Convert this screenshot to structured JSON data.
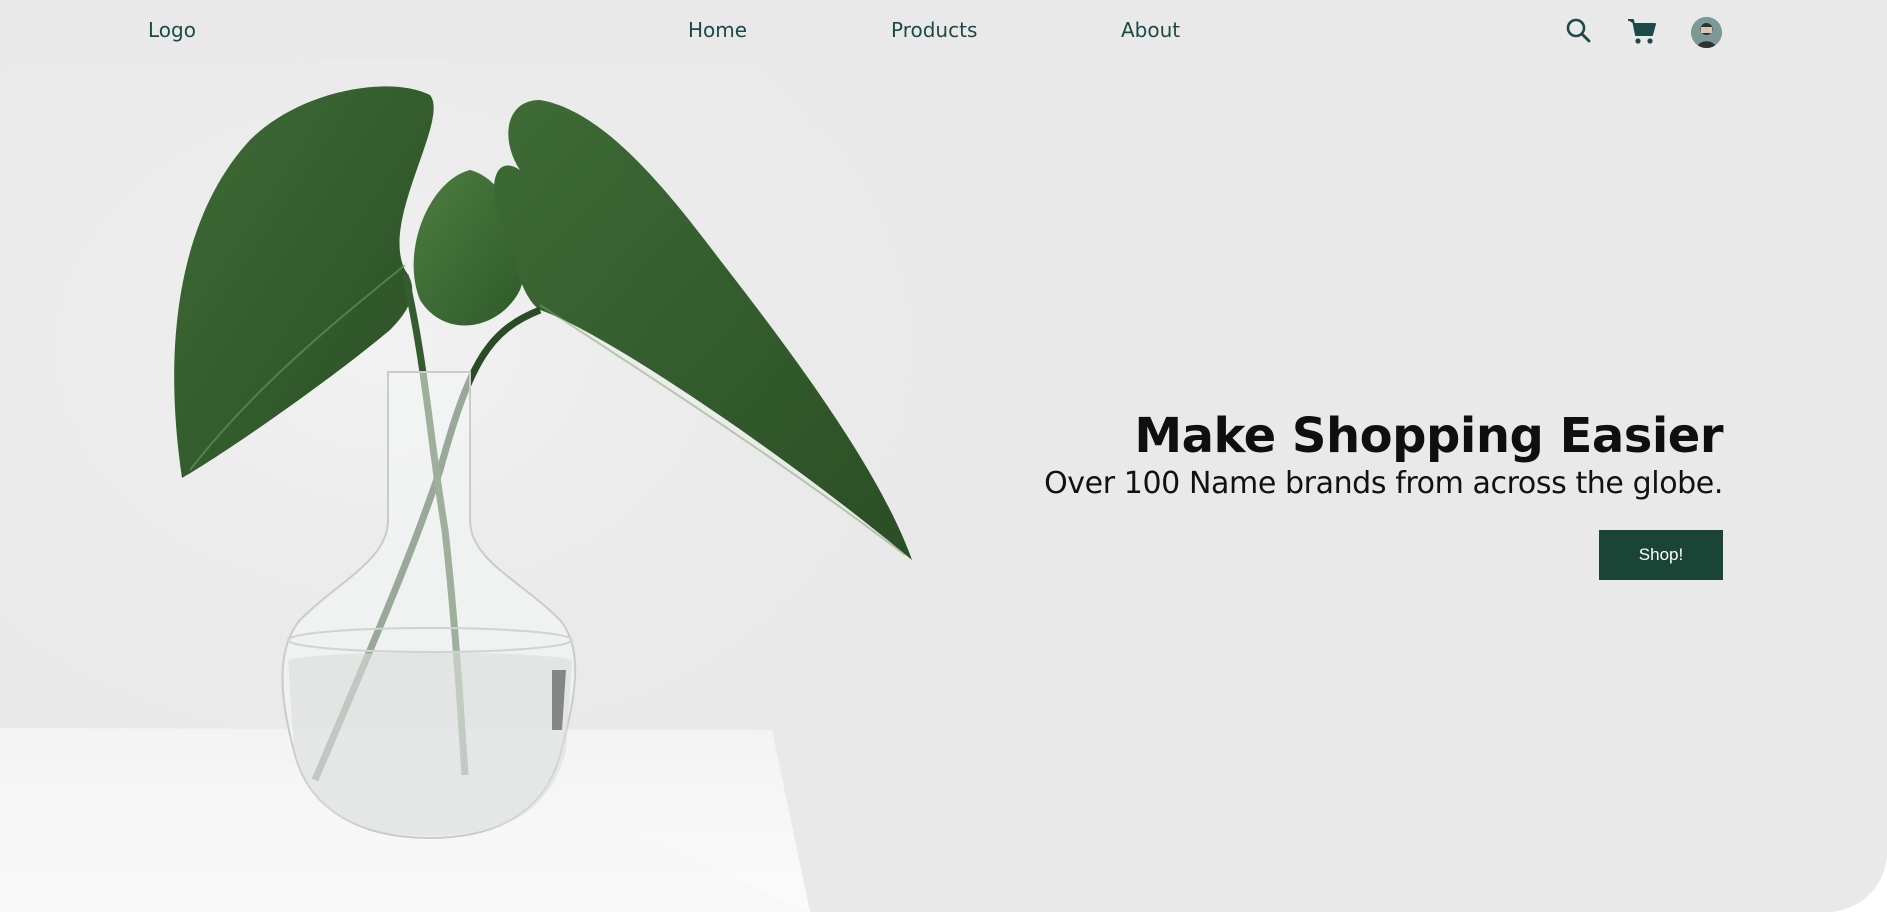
{
  "nav": {
    "logo": "Logo",
    "links": [
      {
        "label": "Home"
      },
      {
        "label": "Products"
      },
      {
        "label": "About"
      }
    ],
    "icons": [
      "search-icon",
      "cart-icon",
      "avatar"
    ]
  },
  "hero": {
    "headline": "Make Shopping Easier",
    "subheadline": "Over 100 Name brands from across the globe.",
    "cta_label": "Shop!"
  },
  "colors": {
    "accent": "#1a4536",
    "nav_text": "#1d4a46",
    "background": "#e9e9e9"
  }
}
